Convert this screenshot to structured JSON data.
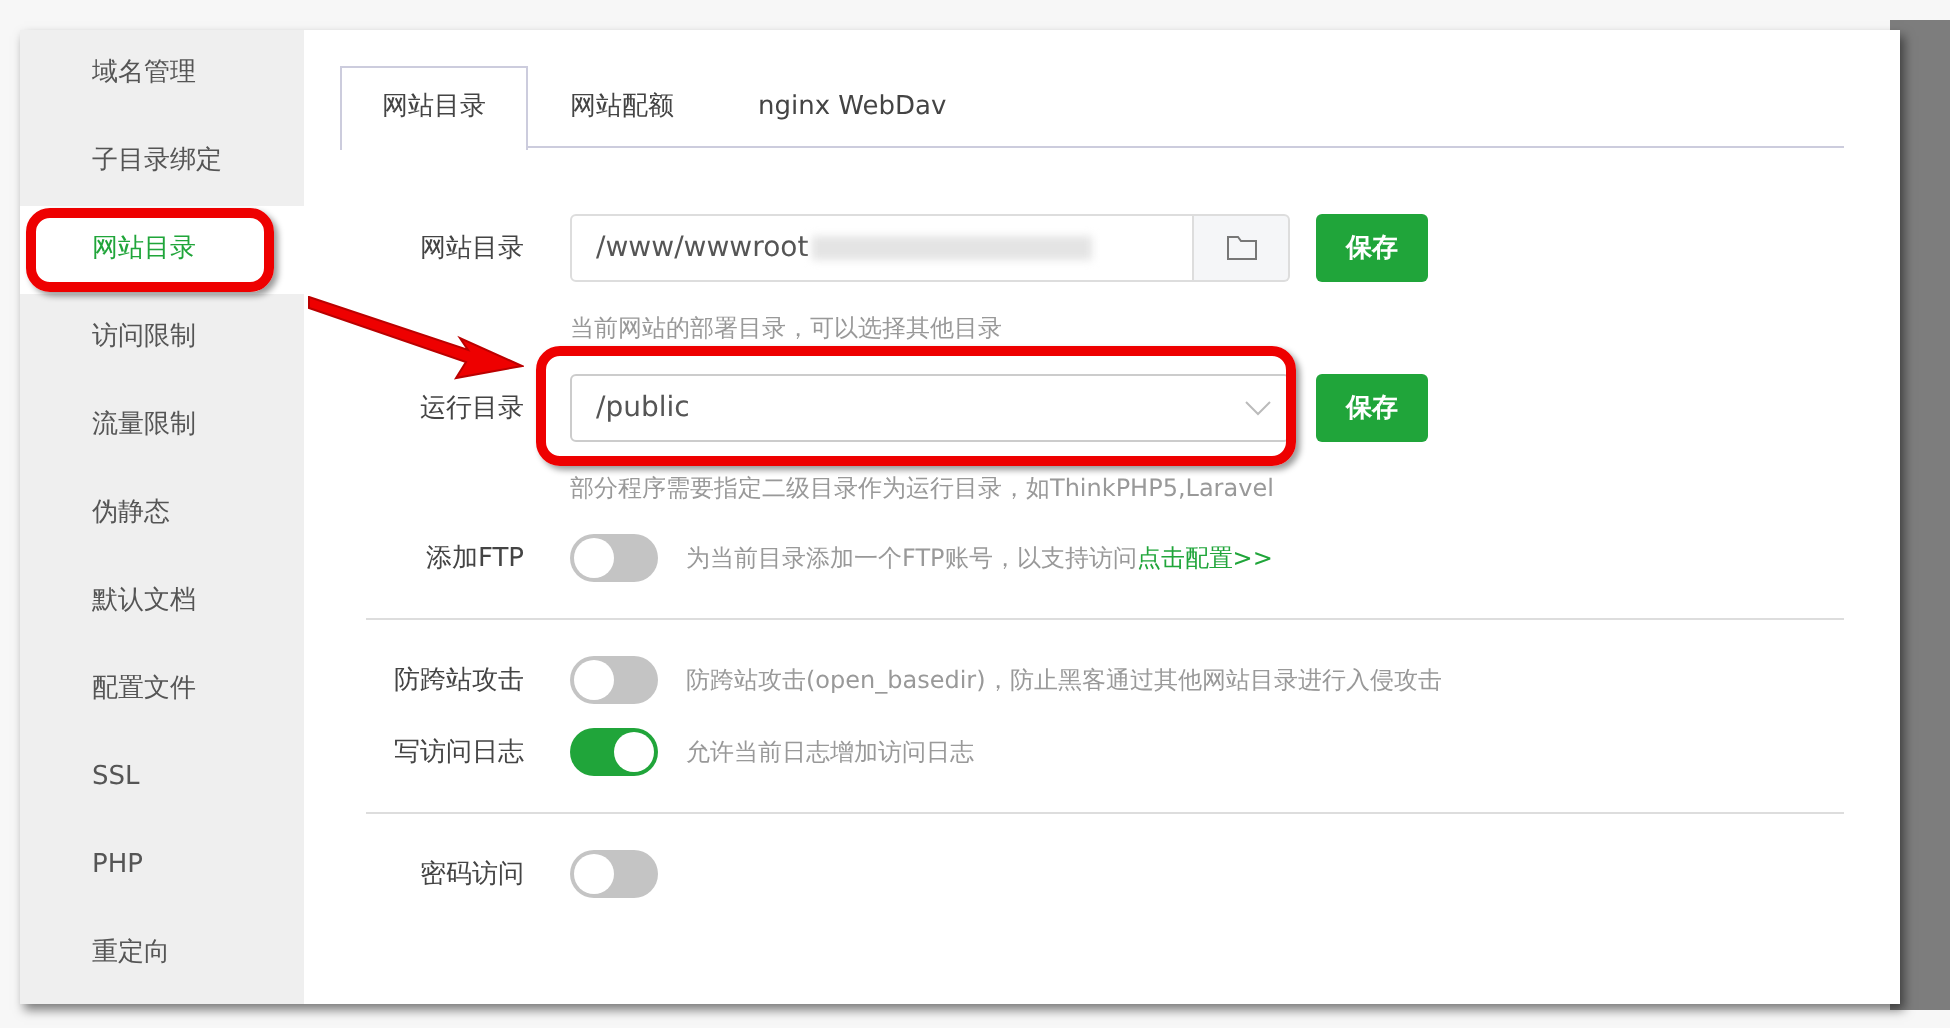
{
  "sidebar": {
    "items": [
      {
        "label": "域名管理",
        "selected": false
      },
      {
        "label": "子目录绑定",
        "selected": false
      },
      {
        "label": "网站目录",
        "selected": true
      },
      {
        "label": "访问限制",
        "selected": false
      },
      {
        "label": "流量限制",
        "selected": false
      },
      {
        "label": "伪静态",
        "selected": false
      },
      {
        "label": "默认文档",
        "selected": false
      },
      {
        "label": "配置文件",
        "selected": false
      },
      {
        "label": "SSL",
        "selected": false
      },
      {
        "label": "PHP",
        "selected": false
      },
      {
        "label": "重定向",
        "selected": false
      }
    ]
  },
  "tabs": [
    {
      "label": "网站目录",
      "selected": true
    },
    {
      "label": "网站配额",
      "selected": false
    },
    {
      "label": "nginx WebDav",
      "selected": false
    }
  ],
  "site_dir": {
    "label": "网站目录",
    "value": "/www/wwwroot",
    "button": "保存",
    "hint": "当前网站的部署目录，可以选择其他目录"
  },
  "run_dir": {
    "label": "运行目录",
    "value": "/public",
    "button": "保存",
    "hint": "部分程序需要指定二级目录作为运行目录，如ThinkPHP5,Laravel"
  },
  "sections": [
    [
      {
        "label": "添加FTP",
        "on": false,
        "text": "为当前目录添加一个FTP账号，以支持访问",
        "link": "点击配置>>"
      }
    ],
    [
      {
        "label": "防跨站攻击",
        "on": false,
        "text": "防跨站攻击(open_basedir)，防止黑客通过其他网站目录进行入侵攻击"
      },
      {
        "label": "写访问日志",
        "on": true,
        "text": "允许当前日志增加访问日志"
      }
    ],
    [
      {
        "label": "密码访问",
        "on": false
      }
    ]
  ]
}
